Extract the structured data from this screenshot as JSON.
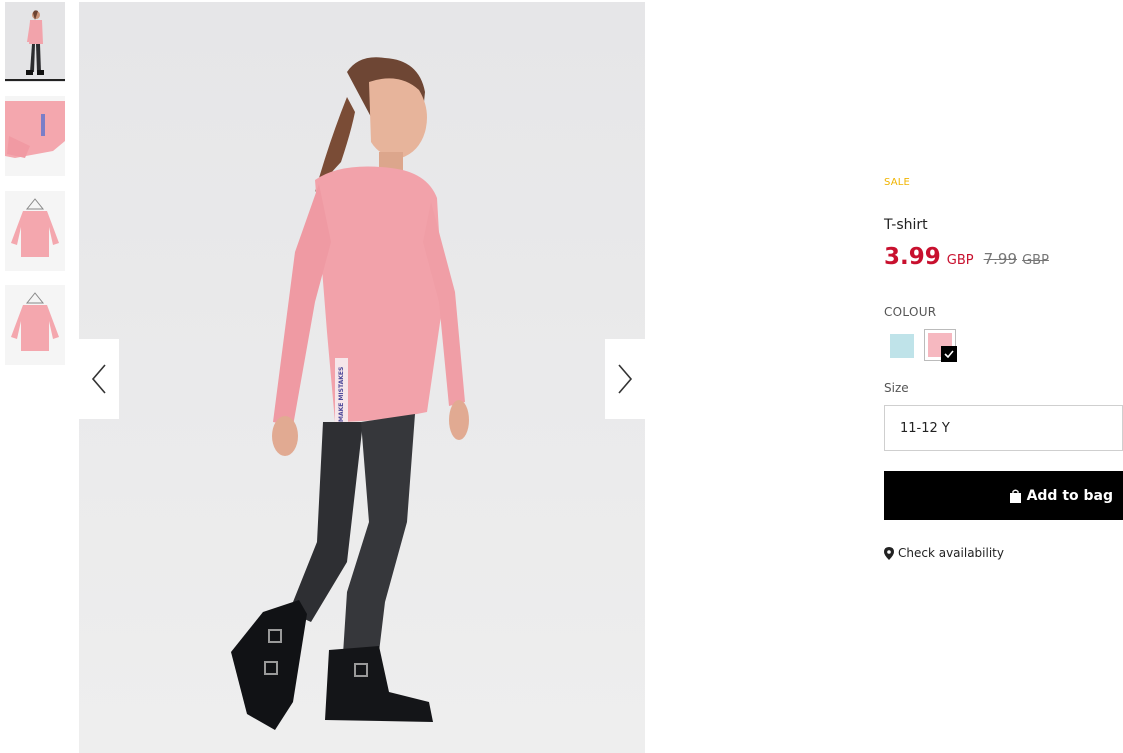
{
  "thumbnails": [
    {
      "name": "thumbnail-girl-walking"
    },
    {
      "name": "thumbnail-sleeve-detail"
    },
    {
      "name": "thumbnail-front-hanger"
    },
    {
      "name": "thumbnail-back-hanger"
    }
  ],
  "gallery": {
    "print_text": "MAKE MISTAKES",
    "prev_icon": "chevron-left-icon",
    "next_icon": "chevron-right-icon"
  },
  "product": {
    "badge": "SALE",
    "name": "T-shirt",
    "price_now": "3.99",
    "price_now_currency": "GBP",
    "price_old": "7.99",
    "price_old_currency": "GBP",
    "colour_label": "COLOUR",
    "size_label": "Size",
    "size_value": "11-12 Y",
    "add_to_bag": "Add to bag",
    "check_availability": "Check availability"
  },
  "colors": {
    "sale": "#f0b400",
    "price": "#c8102e",
    "swatch_blue": "#bfe3e9",
    "swatch_pink": "#f6b8c0",
    "button": "#000000"
  }
}
